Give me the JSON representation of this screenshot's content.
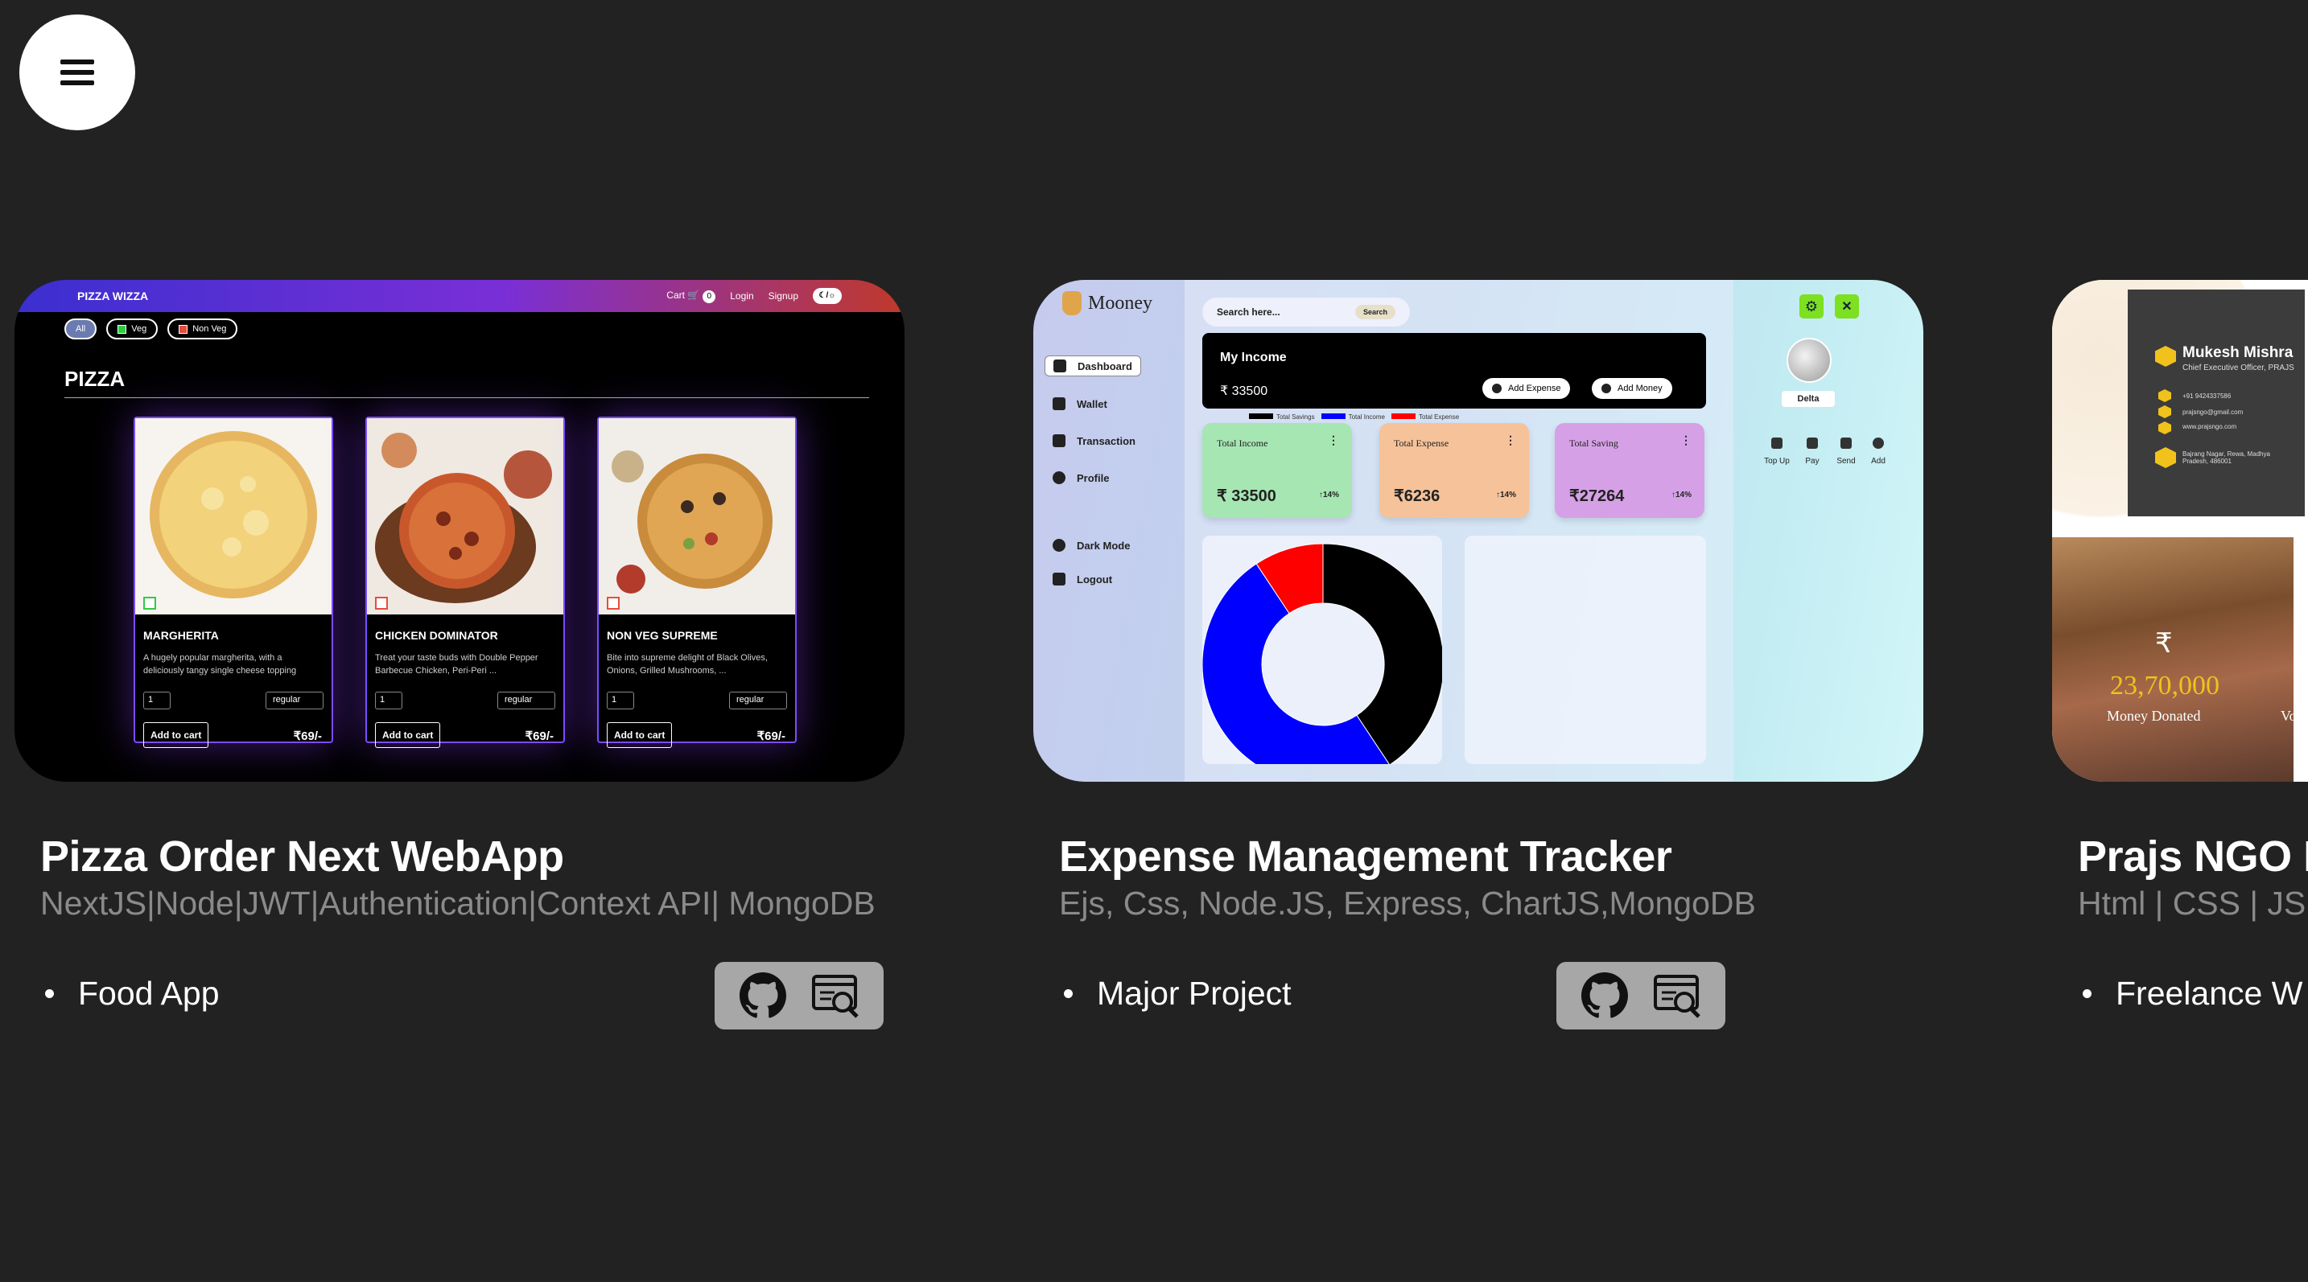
{
  "menu": {
    "icon": "hamburger-menu-icon"
  },
  "projects": [
    {
      "title": "Pizza Order Next WebApp",
      "tech": "NextJS|Node|JWT|Authentication|Context API| MongoDB",
      "bullet": "Food App",
      "links": [
        "github-icon",
        "live-demo-icon"
      ],
      "thumb": {
        "brand": "PIZZA WIZZA",
        "nav": {
          "cart": "Cart",
          "cart_count": "0",
          "login": "Login",
          "signup": "Signup",
          "toggle": "☾/☼"
        },
        "filters": [
          "All",
          "Veg",
          "Non Veg"
        ],
        "heading": "PIZZA",
        "items": [
          {
            "name": "MARGHERITA",
            "desc": "A hugely popular margherita, with a deliciously tangy single cheese topping",
            "qty": "1",
            "size": "regular",
            "add": "Add to cart",
            "price": "₹69/-",
            "veg": true
          },
          {
            "name": "CHICKEN DOMINATOR",
            "desc": "Treat your taste buds with Double Pepper Barbecue Chicken, Peri-Peri ...",
            "qty": "1",
            "size": "regular",
            "add": "Add to cart",
            "price": "₹69/-",
            "veg": false
          },
          {
            "name": "NON VEG SUPREME",
            "desc": "Bite into supreme delight of Black Olives, Onions, Grilled Mushrooms, ...",
            "qty": "1",
            "size": "regular",
            "add": "Add to cart",
            "price": "₹69/-",
            "veg": false
          }
        ]
      }
    },
    {
      "title": "Expense Management Tracker",
      "tech": "Ejs, Css, Node.JS, Express, ChartJS,MongoDB",
      "bullet": "Major Project",
      "links": [
        "github-icon",
        "live-demo-icon"
      ],
      "thumb": {
        "logo": "Mooney",
        "menu": [
          "Dashboard",
          "Wallet",
          "Transaction",
          "Profile",
          "Dark Mode",
          "Logout"
        ],
        "search_placeholder": "Search here...",
        "search_btn": "Search",
        "income_title": "My Income",
        "income_value": "₹  33500",
        "add_expense": "Add Expense",
        "add_money": "Add Money",
        "legend": [
          "Total Savings",
          "Total Income",
          "Total Expense"
        ],
        "stats": [
          {
            "label": "Total Income",
            "value": "₹  33500",
            "pct": "↑14%",
            "color": "#a6e6b3"
          },
          {
            "label": "Total Expense",
            "value": "₹6236",
            "pct": "↑14%",
            "color": "#f5c29a"
          },
          {
            "label": "Total Saving",
            "value": "₹27264",
            "pct": "↑14%",
            "color": "#d6a0e6"
          }
        ],
        "user": "Delta",
        "quick": [
          "Top Up",
          "Pay",
          "Send",
          "Add"
        ],
        "donut": [
          {
            "label": "Total Savings",
            "value": 27264,
            "color": "#000000"
          },
          {
            "label": "Total Income",
            "value": 33500,
            "color": "#0000ff"
          },
          {
            "label": "Total Expense",
            "value": 6236,
            "color": "#ff0000"
          }
        ]
      }
    },
    {
      "title": "Prajs NGO P",
      "tech": "Html | CSS | JS",
      "bullet": "Freelance W",
      "thumb": {
        "card_name": "Mukesh Mishra",
        "card_role": "Chief Executive Officer, PRAJS",
        "card_lines": [
          "+91 9424337586",
          "prajsngo@gmail.com",
          "www.prajsngo.com",
          "Bajrang Nagar, Rewa, Madhya Pradesh, 486001"
        ],
        "rupee": "₹",
        "amount": "23,70,000",
        "amount_label": "Money Donated",
        "side_label": "Vol"
      }
    }
  ]
}
